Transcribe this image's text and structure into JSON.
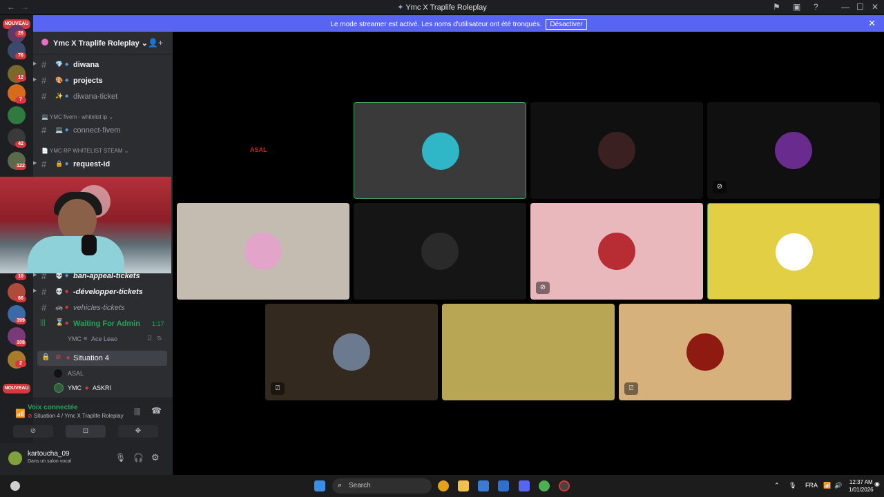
{
  "window": {
    "title": "Ymc X Traplife Roleplay",
    "back": "←",
    "forward": "→"
  },
  "banner": {
    "text": "Le mode streamer est activé. Les noms d'utilisateur ont été tronqués.",
    "button": "Désactiver",
    "close": "✕"
  },
  "servers": {
    "badges": [
      "26",
      "76",
      "12",
      "7",
      "42",
      "122",
      "10",
      "66",
      "399",
      "108",
      "2"
    ],
    "new_label": "NOUVEAU"
  },
  "guild": {
    "name": "Ymc X Traplife Roleplay",
    "chevron": "⌄"
  },
  "channels": [
    {
      "emoji": "💎",
      "name": "diwana"
    },
    {
      "emoji": "🎨",
      "name": "projects"
    },
    {
      "emoji": "✨",
      "name": "diwana-ticket"
    },
    {
      "category": "YMC fivem - whitelist ip"
    },
    {
      "emoji": "💻",
      "name": "connect-fivem"
    },
    {
      "category": "YMC RP WHITELIST STEAM"
    },
    {
      "emoji": "🔒",
      "name": "request-id"
    },
    {
      "emoji": "💀",
      "name": "ban-appeal-tickets"
    },
    {
      "emoji": "💀",
      "name": "-développer-tickets"
    },
    {
      "emoji": "🚓",
      "name": "vehicles-tickets"
    }
  ],
  "voice": {
    "waiting_channel": "Waiting For Admin",
    "waiting_time": "1:17",
    "waiting_user_tag": "YMC",
    "waiting_user": "Ace Leao",
    "situation_channel": "Situation 4",
    "situation_users": [
      {
        "name": "ASAL"
      },
      {
        "tag": "YMC",
        "name": "ASKRI"
      }
    ]
  },
  "voice_panel": {
    "status": "Voix connectée",
    "location": "Situation 4 / Ymc X Traplife Roleplay"
  },
  "user": {
    "name": "kartoucha_09",
    "status": "Dans un salon vocal"
  },
  "stage": {
    "tiles": [
      {
        "bg": "#000000",
        "label": "ASAL",
        "label_color": "#c0242c"
      },
      {
        "bg": "#3a3a3a",
        "speaking": true,
        "av_color": "#2fb7c8"
      },
      {
        "bg": "#101010",
        "av_color": "#3a2020"
      },
      {
        "bg": "#101010",
        "av_color": "#6a2b8f",
        "badge": "camera-off"
      },
      {
        "bg": "#c4bcb0",
        "av_color": "#e2a4c8"
      },
      {
        "bg": "#151515",
        "av_color": "#2a2a2a"
      },
      {
        "bg": "#e9b8bd",
        "av_color": "#b72d33",
        "badge": "camera-off"
      },
      {
        "bg": "#e3cf44",
        "speaking": true,
        "av_color": "#ffffff"
      },
      {
        "bg": "#33291e",
        "av_color": "#6b7a8f",
        "badge": "mic-off"
      },
      {
        "bg": "#b8a655",
        "av_color": "#b8a655"
      },
      {
        "bg": "#d6b17c",
        "av_color": "#8f1a12",
        "badge": "mic-off"
      }
    ]
  },
  "taskbar": {
    "search_placeholder": "Search",
    "lang": "FRA",
    "time": "12:37 AM",
    "date": "1/01/2026"
  }
}
